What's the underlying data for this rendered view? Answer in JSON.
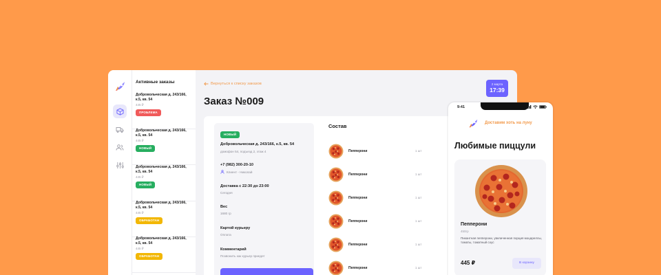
{
  "colors": {
    "background": "#FF9A4A",
    "accent": "#6C63FF",
    "link": "#F2994A",
    "status_problem": "#F05A5A",
    "status_new": "#27AE60",
    "status_processed": "#F2B705"
  },
  "sidebar": {
    "icons": [
      "rocket-logo-icon",
      "box-icon",
      "truck-icon",
      "users-icon",
      "sliders-icon"
    ]
  },
  "orders": {
    "title": "Активные заказы",
    "items": [
      {
        "address": "Добровольческая д. 243/166, к.5, кв. 54",
        "price": "445 ₽",
        "status": "ПРОБЛЕМА"
      },
      {
        "address": "Добровольческая д. 243/166, к.5, кв. 54",
        "price": "445 ₽",
        "status": "НОВЫЙ"
      },
      {
        "address": "Добровольческая д. 243/166, к.5, кв. 54",
        "price": "445 ₽",
        "status": "НОВЫЙ"
      },
      {
        "address": "Добровольческая д. 243/166, к.5, кв. 54",
        "price": "445 ₽",
        "status": "ОБРАБОТАН"
      },
      {
        "address": "Добровольческая д. 243/166, к.5, кв. 54",
        "price": "445 ₽",
        "status": "ОБРАБОТАН"
      }
    ]
  },
  "main": {
    "back_link": "Вернуться к списку заказов",
    "title": "Заказ №009",
    "date": "2 марта",
    "time": "17:39"
  },
  "details": {
    "status": "НОВЫЙ",
    "address": "Добровольческая д. 243/166, к.5, кв. 54",
    "address_sub": "домофон 54, подъезд 2, этаж 4",
    "phone": "+7 (982) 300-20-10",
    "client": "Клиент - Николай",
    "delivery": "Доставка с 22:30 до 23:00",
    "delivery_sub": "Сегодня",
    "weight_label": "Вес",
    "weight": "1680 гр",
    "payment_label": "Картой курьеру",
    "payment_sub": "Оплата",
    "comment_label": "Комментарий",
    "comment": "Позвонить как курьер приедет"
  },
  "composition": {
    "title": "Состав",
    "items": [
      {
        "name": "Пепперони",
        "qty": "1 шт"
      },
      {
        "name": "Пепперони",
        "qty": "1 шт"
      },
      {
        "name": "Пепперони",
        "qty": "1 шт"
      },
      {
        "name": "Пепперони",
        "qty": "1 шт"
      },
      {
        "name": "Пепперони",
        "qty": "1 шт"
      },
      {
        "name": "Пепперони",
        "qty": "1 шт"
      }
    ]
  },
  "phone": {
    "time": "9:41",
    "tagline": "Доставим хоть на луну",
    "title": "Любимые пиццули",
    "product": {
      "name": "Пепперони",
      "weight": "450гр",
      "description": "Пикантная пепперони, увеличенная порция моцареллы, томаты, томатный соус",
      "price": "445 ₽",
      "cart_button": "В корзину"
    }
  }
}
